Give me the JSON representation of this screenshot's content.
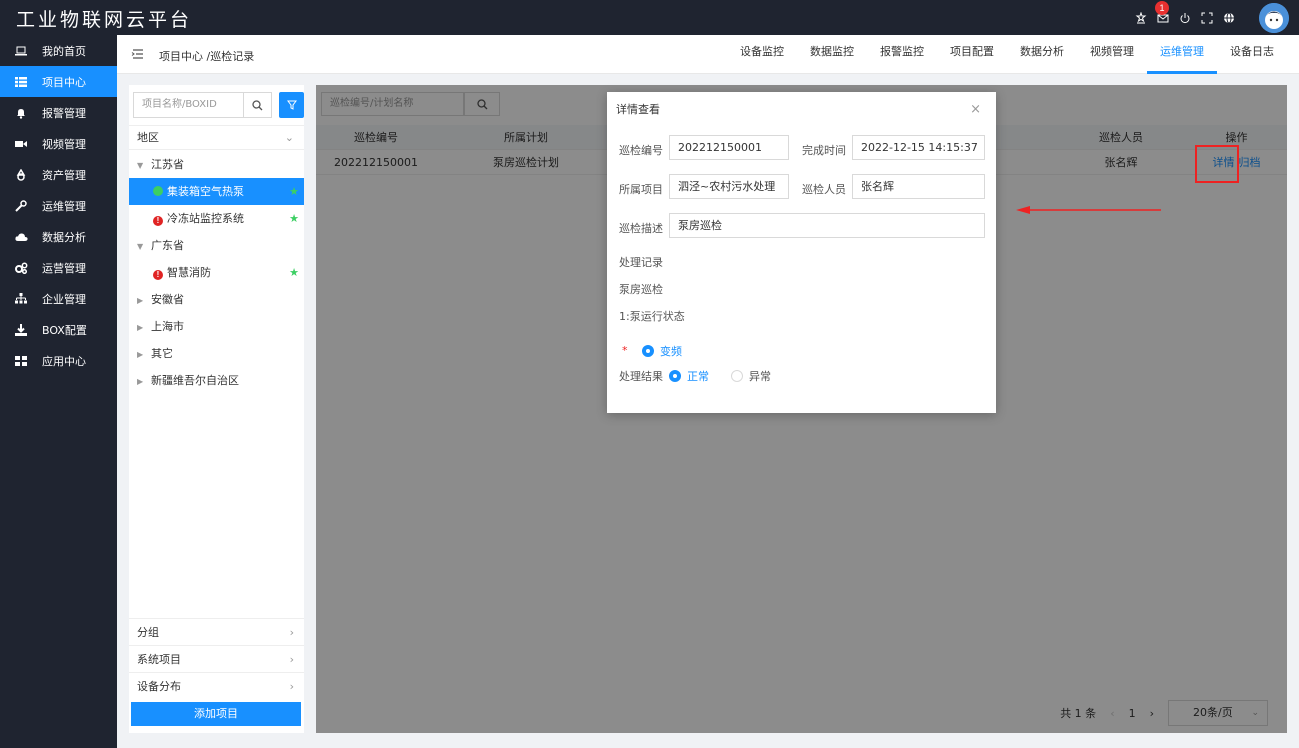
{
  "app": {
    "title": "工业物联网云平台",
    "notification_count": "1",
    "icons": [
      "cert-icon",
      "mail-icon",
      "power-icon",
      "fullscreen-icon",
      "globe-icon"
    ]
  },
  "sidebar": {
    "items": [
      {
        "label": "我的首页",
        "icon": "laptop-icon"
      },
      {
        "label": "项目中心",
        "icon": "list-icon",
        "active": true
      },
      {
        "label": "报警管理",
        "icon": "bell-icon"
      },
      {
        "label": "视频管理",
        "icon": "video-icon"
      },
      {
        "label": "资产管理",
        "icon": "recycle-icon"
      },
      {
        "label": "运维管理",
        "icon": "wrench-icon"
      },
      {
        "label": "数据分析",
        "icon": "cloud-icon"
      },
      {
        "label": "运营管理",
        "icon": "cogs-icon"
      },
      {
        "label": "企业管理",
        "icon": "sitemap-icon"
      },
      {
        "label": "BOX配置",
        "icon": "download-icon"
      },
      {
        "label": "应用中心",
        "icon": "grid-icon"
      }
    ]
  },
  "breadcrumb": "项目中心 /巡检记录",
  "tabs": [
    {
      "label": "设备监控"
    },
    {
      "label": "数据监控"
    },
    {
      "label": "报警监控"
    },
    {
      "label": "项目配置"
    },
    {
      "label": "数据分析"
    },
    {
      "label": "视频管理"
    },
    {
      "label": "运维管理",
      "active": true
    },
    {
      "label": "设备日志"
    }
  ],
  "project_panel": {
    "search_placeholder": "项目名称/BOXID",
    "region_label": "地区",
    "tree": [
      {
        "level": 0,
        "label": "江苏省",
        "expanded": true
      },
      {
        "level": 1,
        "label": "集装箱空气热泵",
        "status": "ok",
        "starred": true,
        "selected": true
      },
      {
        "level": 1,
        "label": "冷冻站监控系统",
        "status": "err",
        "starred": true
      },
      {
        "level": 0,
        "label": "广东省",
        "expanded": true
      },
      {
        "level": 1,
        "label": "智慧消防",
        "status": "err",
        "starred": true
      },
      {
        "level": 0,
        "label": "安徽省",
        "expanded": false
      },
      {
        "level": 0,
        "label": "上海市",
        "expanded": false
      },
      {
        "level": 0,
        "label": "其它",
        "expanded": false
      },
      {
        "level": 0,
        "label": "新疆维吾尔自治区",
        "expanded": false
      }
    ],
    "groups": [
      "分组",
      "系统项目",
      "设备分布"
    ],
    "add_button": "添加项目"
  },
  "records": {
    "search_placeholder": "巡检编号/计划名称",
    "columns": {
      "id": "巡检编号",
      "plan": "所属计划",
      "inspector": "巡检人员",
      "action": "操作"
    },
    "rows": [
      {
        "id": "202212150001",
        "plan": "泵房巡检计划",
        "inspector": "张名辉",
        "action_detail": "详情",
        "action_archive": "归档"
      }
    ],
    "pager": {
      "total": "共 1 条",
      "current": "1",
      "page_size": "20条/页"
    }
  },
  "dialog": {
    "title": "详情查看",
    "close": "×",
    "fields": {
      "id_label": "巡检编号",
      "id_value": "202212150001",
      "finish_label": "完成时间",
      "finish_value": "2022-12-15 14:15:37",
      "project_label": "所属项目",
      "project_value": "泗泾~农村污水处理",
      "inspector_label": "巡检人员",
      "inspector_value": "张名辉",
      "desc_label": "巡检描述",
      "desc_value": "泵房巡检"
    },
    "record_title": "处理记录",
    "record_name": "泵房巡检",
    "item_title": "1:泵运行状态",
    "required_mark": "*",
    "option_selected": "变频",
    "result_label": "处理结果",
    "result_options": [
      {
        "label": "正常",
        "checked": true
      },
      {
        "label": "异常",
        "checked": false
      }
    ]
  },
  "colors": {
    "accent": "#1890ff",
    "nav_bg": "#1f2430",
    "highlight": "#e22222",
    "ok": "#3ccf63",
    "err": "#e02424"
  }
}
